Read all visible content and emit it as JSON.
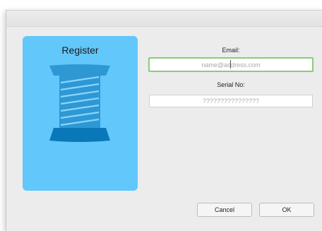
{
  "dialog": {
    "card_title": "Register",
    "email": {
      "label": "Email:",
      "value": "",
      "placeholder": "name@address.com"
    },
    "serial": {
      "label": "Serial No:",
      "value": "",
      "placeholder": "????????????????"
    },
    "buttons": {
      "cancel": "Cancel",
      "ok": "OK"
    }
  },
  "colors": {
    "card_background": "#62c7fb",
    "spool_dark": "#0a78b8",
    "spool_mid": "#2e98d4",
    "focus_ring": "#8bcb78"
  },
  "icons": {
    "card": "thread-spool-icon"
  }
}
